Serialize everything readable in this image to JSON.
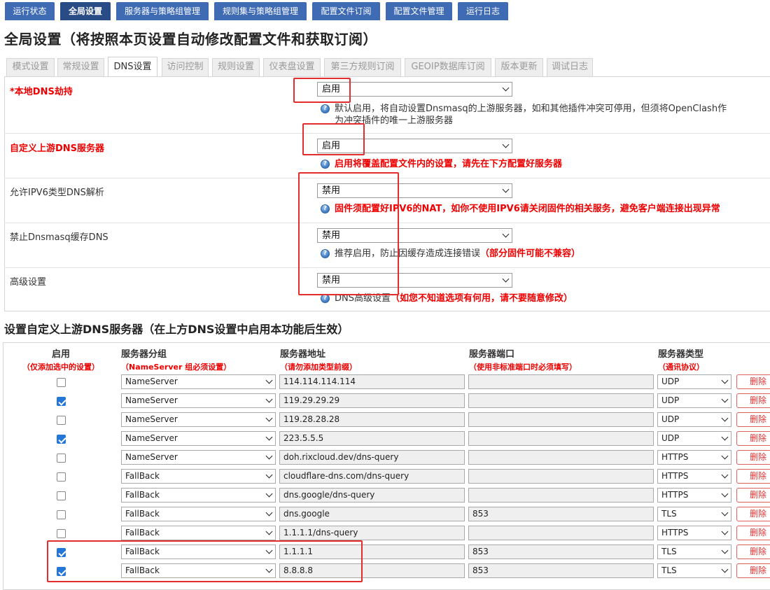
{
  "top_nav": [
    {
      "label": "运行状态",
      "active": false
    },
    {
      "label": "全局设置",
      "active": true
    },
    {
      "label": "服务器与策略组管理",
      "active": false
    },
    {
      "label": "规则集与策略组管理",
      "active": false
    },
    {
      "label": "配置文件订阅",
      "active": false
    },
    {
      "label": "配置文件管理",
      "active": false
    },
    {
      "label": "运行日志",
      "active": false
    }
  ],
  "page_title": "全局设置（将按照本页设置自动修改配置文件和获取订阅）",
  "sub_tabs": [
    {
      "label": "模式设置",
      "active": false
    },
    {
      "label": "常规设置",
      "active": false
    },
    {
      "label": "DNS设置",
      "active": true
    },
    {
      "label": "访问控制",
      "active": false
    },
    {
      "label": "规则设置",
      "active": false
    },
    {
      "label": "仪表盘设置",
      "active": false
    },
    {
      "label": "第三方规则订阅",
      "active": false
    },
    {
      "label": "GEOIP数据库订阅",
      "active": false
    },
    {
      "label": "版本更新",
      "active": false
    },
    {
      "label": "调试日志",
      "active": false
    }
  ],
  "settings": [
    {
      "label": "*本地DNS劫持",
      "value": "启用",
      "note_line1": "默认启用，将自动设置Dnsmasq的上游服务器，如和其他插件冲突可停用，但须将OpenClash作",
      "note_line2": "为冲突插件的唯一上游服务器"
    },
    {
      "label": "自定义上游DNS服务器",
      "value": "启用",
      "note": "启用将覆盖配置文件内的设置，请先在下方配置好服务器"
    },
    {
      "label": "允许IPV6类型DNS解析",
      "value": "禁用",
      "note": "固件须配置好IPV6的NAT，如你不使用IPV6请关闭固件的相关服务，避免客户端连接出现异常"
    },
    {
      "label": "禁止Dnsmasq缓存DNS",
      "value": "禁用",
      "note": "推荐启用，防止因缓存造成连接错误",
      "note_red": "（部分固件可能不兼容）"
    },
    {
      "label": "高级设置",
      "value": "禁用",
      "note": "DNS高级设置",
      "note_red": "（如您不知道选项有何用，请不要随意修改）"
    }
  ],
  "section_title": "设置自定义上游DNS服务器（在上方DNS设置中启用本功能后生效）",
  "table": {
    "headers": [
      {
        "title": "启用",
        "sub": "（仅添加选中的设置）"
      },
      {
        "title": "服务器分组",
        "sub": "（NameServer 组必须设置）"
      },
      {
        "title": "服务器地址",
        "sub": "（请勿添加类型前缀）"
      },
      {
        "title": "服务器端口",
        "sub": "（使用非标准端口时必须填写）"
      },
      {
        "title": "服务器类型",
        "sub": "（通讯协议）"
      }
    ],
    "delete_label": "删除",
    "rows": [
      {
        "enabled": false,
        "group": "NameServer",
        "address": "114.114.114.114",
        "port": "",
        "type": "UDP"
      },
      {
        "enabled": true,
        "group": "NameServer",
        "address": "119.29.29.29",
        "port": "",
        "type": "UDP"
      },
      {
        "enabled": false,
        "group": "NameServer",
        "address": "119.28.28.28",
        "port": "",
        "type": "UDP"
      },
      {
        "enabled": true,
        "group": "NameServer",
        "address": "223.5.5.5",
        "port": "",
        "type": "UDP"
      },
      {
        "enabled": false,
        "group": "NameServer",
        "address": "doh.rixcloud.dev/dns-query",
        "port": "",
        "type": "HTTPS"
      },
      {
        "enabled": false,
        "group": "FallBack",
        "address": "cloudflare-dns.com/dns-query",
        "port": "",
        "type": "HTTPS"
      },
      {
        "enabled": false,
        "group": "FallBack",
        "address": "dns.google/dns-query",
        "port": "",
        "type": "HTTPS"
      },
      {
        "enabled": false,
        "group": "FallBack",
        "address": "dns.google",
        "port": "853",
        "type": "TLS"
      },
      {
        "enabled": false,
        "group": "FallBack",
        "address": "1.1.1.1/dns-query",
        "port": "",
        "type": "HTTPS"
      },
      {
        "enabled": true,
        "group": "FallBack",
        "address": "1.1.1.1",
        "port": "853",
        "type": "TLS"
      },
      {
        "enabled": true,
        "group": "FallBack",
        "address": "8.8.8.8",
        "port": "853",
        "type": "TLS"
      }
    ]
  },
  "colors": {
    "nav_bg": "#3f6bb5",
    "nav_active": "#2a4c86",
    "warning_red": "#e00000",
    "annotation_red": "#e52c2c",
    "checkbox_blue": "#2477d6"
  }
}
